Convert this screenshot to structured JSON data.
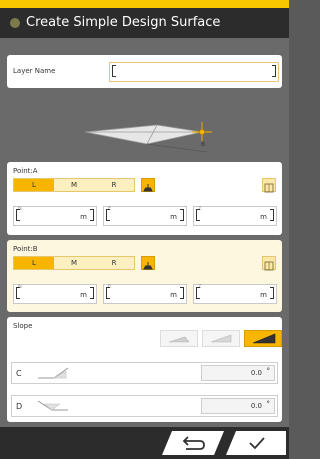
{
  "header": {
    "title": "Create Simple Design Surface"
  },
  "layer": {
    "label": "Layer Name",
    "value": ""
  },
  "preview": {
    "point_label": "B"
  },
  "pointA": {
    "title": "Point:A",
    "options": [
      "L",
      "M",
      "R"
    ],
    "selected": "L",
    "fields": [
      {
        "axis": "N",
        "unit": "m"
      },
      {
        "axis": "E",
        "unit": "m"
      },
      {
        "axis": "Z",
        "unit": "m"
      }
    ]
  },
  "pointB": {
    "title": "Point:B",
    "options": [
      "L",
      "M",
      "R"
    ],
    "selected": "L",
    "fields": [
      {
        "axis": "N",
        "unit": "m"
      },
      {
        "axis": "E",
        "unit": "m"
      },
      {
        "axis": "Z",
        "unit": "m"
      }
    ]
  },
  "slope": {
    "title": "Slope",
    "rows": [
      {
        "label": "C",
        "value": "0.0",
        "unit": "°"
      },
      {
        "label": "D",
        "value": "0.0",
        "unit": "°"
      }
    ]
  },
  "colors": {
    "accent": "#f7b500",
    "header": "#2c2c2c",
    "topbar": "#f7c800"
  },
  "icons": {
    "back": "return-arrow-icon",
    "ok": "checkmark-icon",
    "pick": "excavator-pick-icon",
    "book": "book-icon"
  }
}
